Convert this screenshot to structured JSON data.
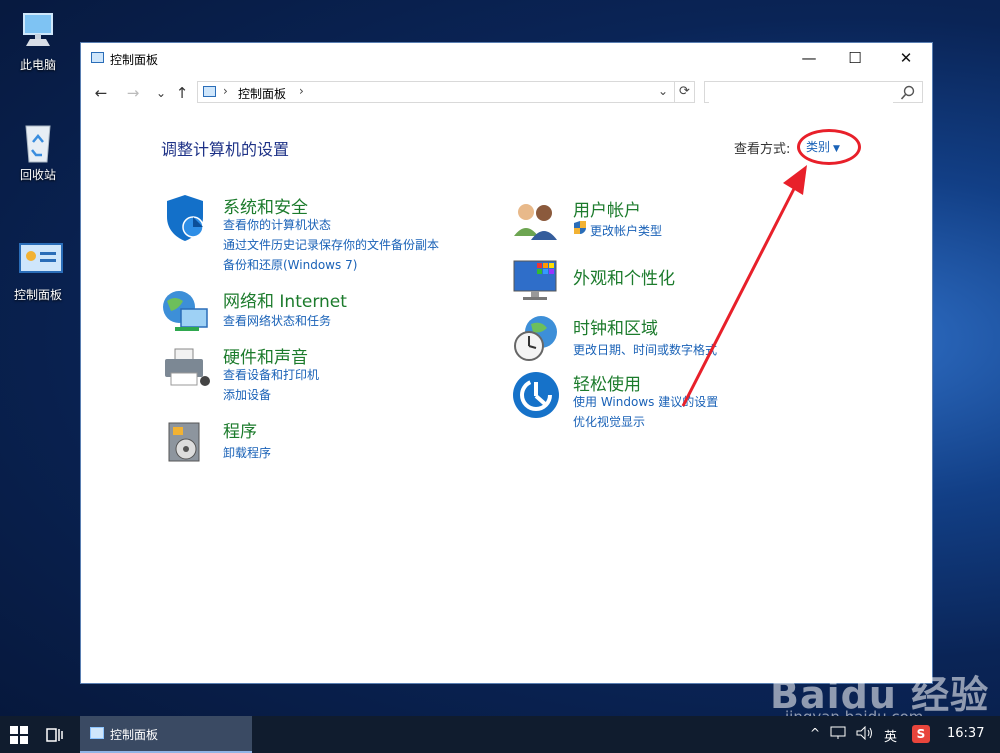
{
  "desktop": {
    "icons": [
      {
        "label": "此电脑"
      },
      {
        "label": "回收站"
      },
      {
        "label": "控制面板"
      }
    ]
  },
  "window": {
    "title": "控制面板",
    "minimize": "—",
    "maximize": "☐",
    "close": "✕"
  },
  "nav": {
    "back": "←",
    "forward": "→",
    "recent": "⌄",
    "up": "↑",
    "sep": "›",
    "crumb": "控制面板",
    "dropdown": "⌄",
    "refresh": "⟳",
    "search_placeholder": ""
  },
  "content": {
    "heading": "调整计算机的设置",
    "view_by_label": "查看方式:",
    "view_by_value": "类别",
    "categories_left": [
      {
        "title": "系统和安全",
        "links": [
          "查看你的计算机状态",
          "通过文件历史记录保存你的文件备份副本",
          "备份和还原(Windows 7)"
        ]
      },
      {
        "title": "网络和 Internet",
        "links": [
          "查看网络状态和任务"
        ]
      },
      {
        "title": "硬件和声音",
        "links": [
          "查看设备和打印机",
          "添加设备"
        ]
      },
      {
        "title": "程序",
        "links": [
          "卸载程序"
        ]
      }
    ],
    "categories_right": [
      {
        "title": "用户帐户",
        "links": [
          "更改帐户类型"
        ]
      },
      {
        "title": "外观和个性化",
        "links": []
      },
      {
        "title": "时钟和区域",
        "links": [
          "更改日期、时间或数字格式"
        ]
      },
      {
        "title": "轻松使用",
        "links": [
          "使用 Windows 建议的设置",
          "优化视觉显示"
        ]
      }
    ]
  },
  "watermark": {
    "logo": "Baidu 经验",
    "url": "jingyan.baidu.com"
  },
  "taskbar": {
    "app_label": "控制面板",
    "tray_up": "^",
    "tray_ime": "英",
    "tray_s": "S",
    "clock": "16:37"
  },
  "colors": {
    "link": "#1a62b7",
    "category_title": "#1c7b2c",
    "heading": "#1e3287",
    "annotation": "#e8202a"
  }
}
